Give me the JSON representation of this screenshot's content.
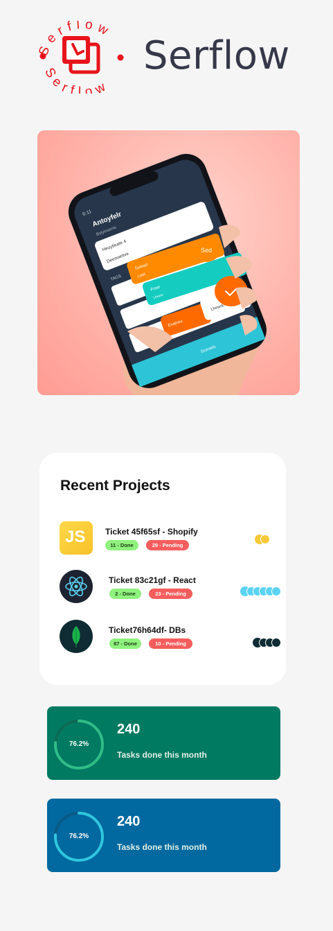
{
  "brand": {
    "name": "Serflow",
    "ring_text_top": "Serflow",
    "ring_text_bottom": "Serflow",
    "accent": "#e8141b"
  },
  "hero": {
    "description_image": "hand-holding-phone",
    "phone_screen": {
      "status": "6:11",
      "header_title": "Antoyfelr",
      "header_subtitle": "Bolyinsenis",
      "field_1": "Heuytieate 4",
      "field_2": "Deeswetive",
      "section": "TAGS",
      "chip_1": "Sutead",
      "chip_2": "Loel",
      "chip_3": "Frast",
      "chip_4": "Ltewre",
      "chip_5": "Evatnes",
      "chip_6": "Lhewrk",
      "fab_label": "Sed",
      "bottom_label": "Scenetis"
    }
  },
  "projects": {
    "title": "Recent Projects",
    "items": [
      {
        "name": "Ticket 45f65sf - Shopify",
        "done": "11 - Done",
        "pending": "29 - Pending",
        "icon": "js-icon",
        "icon_text": "JS",
        "dot_color": "#f5c93a",
        "dot_count": 2
      },
      {
        "name": "Ticket 83c21gf - React",
        "done": "2 - Done",
        "pending": "23 - Pending",
        "icon": "react-icon",
        "icon_text": "",
        "dot_color": "#5bd3f2",
        "dot_count": 6
      },
      {
        "name": "Ticket76h64df- DBs",
        "done": "87 - Done",
        "pending": "10 - Pending",
        "icon": "mongodb-leaf-icon",
        "icon_text": "",
        "dot_color": "#0f2b33",
        "dot_count": 4
      }
    ]
  },
  "stats": [
    {
      "value": "240",
      "label": "Tasks done this month",
      "percent": "76.2%",
      "fraction": 0.762,
      "bg": "#017a62",
      "ring": "#2fbd86"
    },
    {
      "value": "240",
      "label": "Tasks done this month",
      "percent": "76.2%",
      "fraction": 0.762,
      "bg": "#01699f",
      "ring": "#2fc6df"
    }
  ]
}
